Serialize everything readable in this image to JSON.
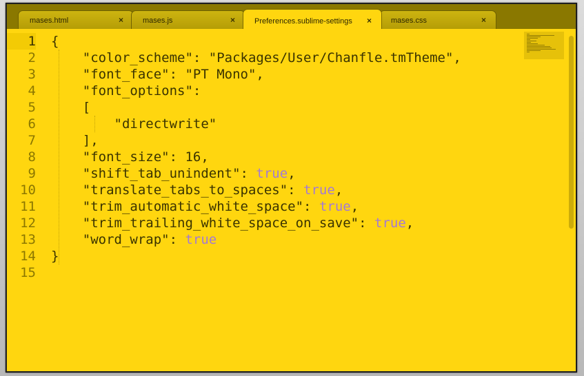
{
  "tabs": [
    {
      "label": "mases.html",
      "close": "×"
    },
    {
      "label": "mases.js",
      "close": "×"
    },
    {
      "label": "Preferences.sublime-settings",
      "close": "×"
    },
    {
      "label": "mases.css",
      "close": "×"
    }
  ],
  "active_tab": 2,
  "line_numbers": [
    "1",
    "2",
    "3",
    "4",
    "5",
    "6",
    "7",
    "8",
    "9",
    "10",
    "11",
    "12",
    "13",
    "14",
    "15"
  ],
  "current_line": 1,
  "code_lines": [
    {
      "text": "{"
    },
    {
      "text": "    \"color_scheme\": \"Packages/User/Chanfle.tmTheme\","
    },
    {
      "text": "    \"font_face\": \"PT Mono\","
    },
    {
      "text": "    \"font_options\":"
    },
    {
      "text": "    ["
    },
    {
      "text": "        \"directwrite\""
    },
    {
      "text": "    ],"
    },
    {
      "text": "    \"font_size\": 16,"
    },
    {
      "pre": "    \"shift_tab_unindent\": ",
      "kw": "true",
      "post": ","
    },
    {
      "pre": "    \"translate_tabs_to_spaces\": ",
      "kw": "true",
      "post": ","
    },
    {
      "pre": "    \"trim_automatic_white_space\": ",
      "kw": "true",
      "post": ","
    },
    {
      "pre": "    \"trim_trailing_white_space_on_save\": ",
      "kw": "true",
      "post": ","
    },
    {
      "pre": "    \"word_wrap\": ",
      "kw": "true",
      "post": ""
    },
    {
      "text": "}"
    },
    {
      "text": ""
    }
  ],
  "colors": {
    "editor_bg": "#ffd60f",
    "text": "#3a3300",
    "keyword_true": "#a37ad6",
    "line_number": "#8b7700"
  }
}
